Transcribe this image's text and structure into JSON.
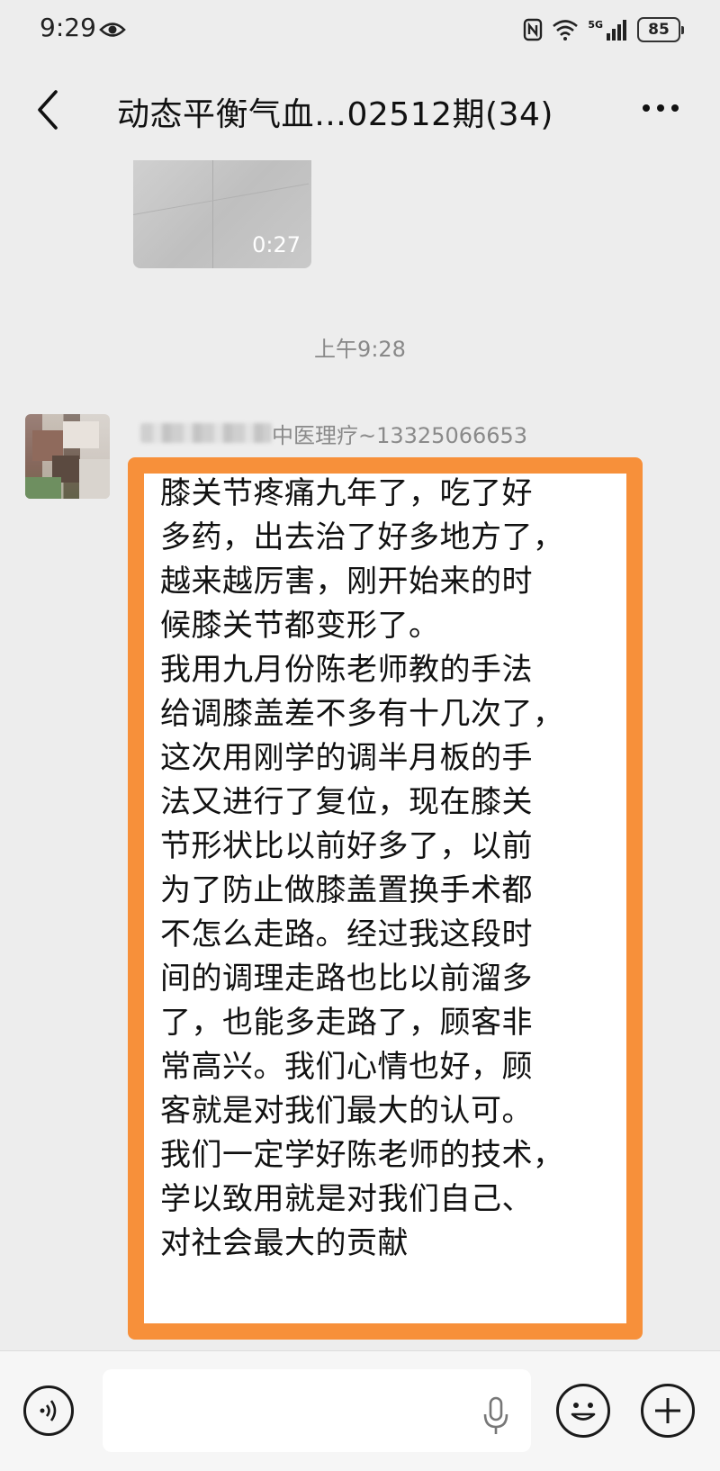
{
  "status_bar": {
    "time": "9:29",
    "network": "5G",
    "battery": "85",
    "icons": [
      "eye-icon",
      "nfc-icon",
      "wifi-icon",
      "signal-icon",
      "battery-icon"
    ]
  },
  "nav": {
    "title": "动态平衡气血…02512期(34)",
    "icons": [
      "back-arrow-icon",
      "more-dots-icon"
    ]
  },
  "video_message": {
    "duration": "0:27"
  },
  "timestamp": "上午9:28",
  "message": {
    "sender_visible_suffix": "中医理疗~13325066653",
    "text": "膝关节疼痛九年了，吃了好\n多药，出去治了好多地方了，\n越来越厉害，刚开始来的时\n候膝关节都变形了。\n我用九月份陈老师教的手法\n给调膝盖差不多有十几次了，\n这次用刚学的调半月板的手\n法又进行了复位，现在膝关\n节形状比以前好多了，以前\n为了防止做膝盖置换手术都\n不怎么走路。经过我这段时\n间的调理走路也比以前溜多\n了，也能多走路了，顾客非\n常高兴。我们心情也好，顾\n客就是对我们最大的认可。\n我们一定学好陈老师的技术，\n学以致用就是对我们自己、\n对社会最大的贡献",
    "highlight_color": "#f7903a"
  },
  "input_bar": {
    "icons": [
      "voice-icon",
      "mic-icon",
      "emoji-icon",
      "plus-icon"
    ]
  }
}
